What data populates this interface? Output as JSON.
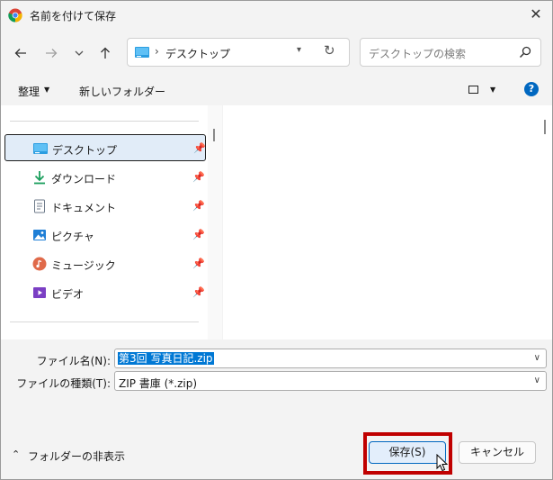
{
  "window": {
    "title": "名前を付けて保存"
  },
  "address": {
    "location": "デスクトップ",
    "separator": "›"
  },
  "search": {
    "placeholder": "デスクトップの検索"
  },
  "toolbar": {
    "organize_label": "整理",
    "new_folder_label": "新しいフォルダー",
    "help_label": "?"
  },
  "navpane": {
    "items": [
      {
        "label": "デスクトップ",
        "icon": "desktop-icon",
        "selected": true
      },
      {
        "label": "ダウンロード",
        "icon": "download-icon"
      },
      {
        "label": "ドキュメント",
        "icon": "document-icon"
      },
      {
        "label": "ピクチャ",
        "icon": "pictures-icon"
      },
      {
        "label": "ミュージック",
        "icon": "music-icon"
      },
      {
        "label": "ビデオ",
        "icon": "video-icon"
      }
    ]
  },
  "fields": {
    "filename_label": "ファイル名(N):",
    "filename_value": "第3回 写真日記.zip",
    "filetype_label": "ファイルの種類(T):",
    "filetype_value": "ZIP 書庫 (*.zip)"
  },
  "footer": {
    "hide_folders_label": "フォルダーの非表示",
    "save_label": "保存(S)",
    "cancel_label": "キャンセル"
  },
  "colors": {
    "accent": "#0067c0",
    "selection": "#0078d4",
    "highlight_frame": "#c00000"
  }
}
